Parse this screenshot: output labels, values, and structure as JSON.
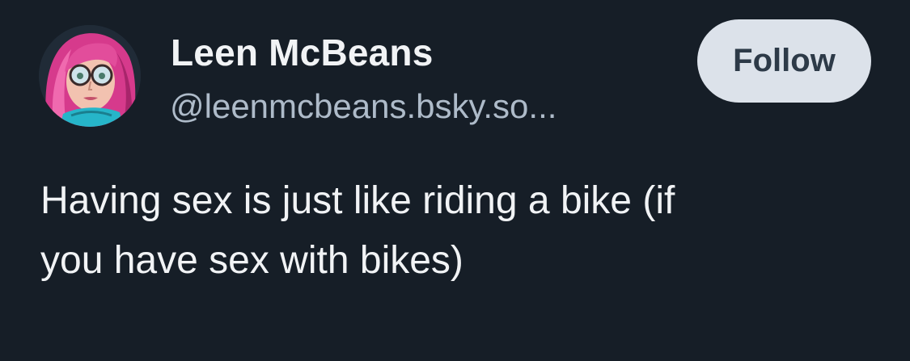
{
  "author": {
    "display_name": "Leen McBeans",
    "handle": "@leenmcbeans.bsky.so...",
    "avatar_icon": "cartoon-avatar-pink-hair-glasses"
  },
  "actions": {
    "follow_label": "Follow"
  },
  "post": {
    "text": "Having sex is just like riding a bike (if\nyou have sex with bikes)"
  },
  "colors": {
    "background": "#161e27",
    "text_primary": "#f1f3f5",
    "text_secondary": "#aebbc9",
    "button_bg": "#dce2ea",
    "button_text": "#2d3a48"
  }
}
